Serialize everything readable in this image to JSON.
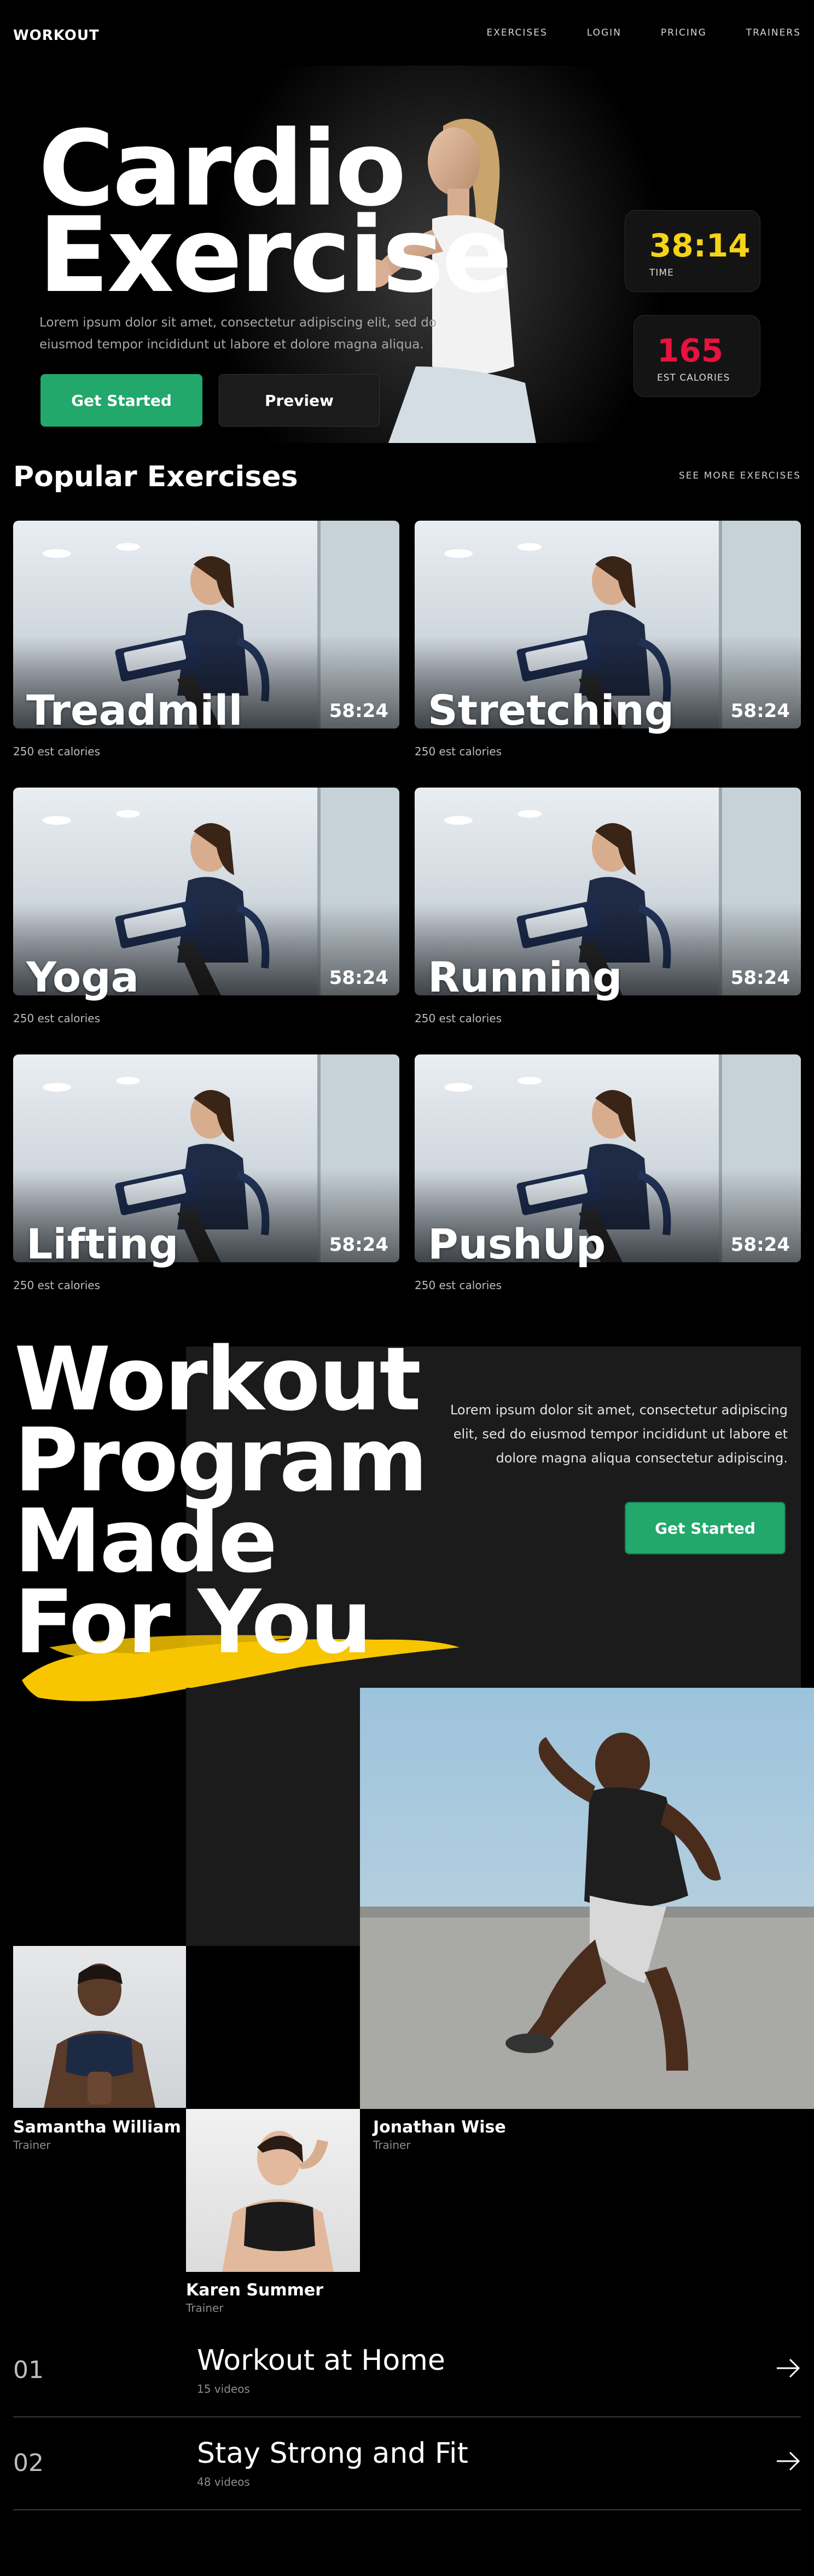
{
  "nav": {
    "logo": "WORKOUT",
    "links": [
      "EXERCISES",
      "LOGIN",
      "PRICING",
      "TRAINERS"
    ]
  },
  "hero": {
    "title_line1": "Cardio",
    "title_line2": "Exercise",
    "subtitle": "Lorem ipsum dolor sit amet, consectetur adipiscing elit, sed do eiusmod tempor incididunt ut labore et dolore magna aliqua.",
    "primary_button": "Get Started",
    "secondary_button": "Preview",
    "stats": [
      {
        "value": "38:14",
        "label": "TIME",
        "color": "#f5d318"
      },
      {
        "value": "165",
        "label": "EST CALORIES",
        "color": "#e8123f"
      }
    ]
  },
  "popular": {
    "title": "Popular Exercises",
    "see_more": "SEE MORE EXERCISES",
    "cards": [
      {
        "name": "Treadmill",
        "time": "58:24",
        "calories": "250 est calories"
      },
      {
        "name": "Stretching",
        "time": "58:24",
        "calories": "250 est calories"
      },
      {
        "name": "Yoga",
        "time": "58:24",
        "calories": "250 est calories"
      },
      {
        "name": "Running",
        "time": "58:24",
        "calories": "250 est calories"
      },
      {
        "name": "Lifting",
        "time": "58:24",
        "calories": "250 est calories"
      },
      {
        "name": "PushUp",
        "time": "58:24",
        "calories": "250 est calories"
      }
    ]
  },
  "program": {
    "title_line1": "Workout",
    "title_line2": "Program",
    "title_line3": "Made",
    "title_line4": "For You",
    "text": "Lorem ipsum dolor sit amet, consectetur adipiscing elit, sed do eiusmod tempor incididunt ut labore et dolore magna aliqua consectetur adipiscing.",
    "button": "Get Started",
    "accent_color": "#f7c600"
  },
  "trainers": [
    {
      "name": "Samantha William",
      "role": "Trainer"
    },
    {
      "name": "Jonathan Wise",
      "role": "Trainer"
    },
    {
      "name": "Karen Summer",
      "role": "Trainer"
    }
  ],
  "videos": [
    {
      "number": "01",
      "title": "Workout at Home",
      "count": "15 videos"
    },
    {
      "number": "02",
      "title": "Stay Strong and Fit",
      "count": "48 videos"
    }
  ]
}
